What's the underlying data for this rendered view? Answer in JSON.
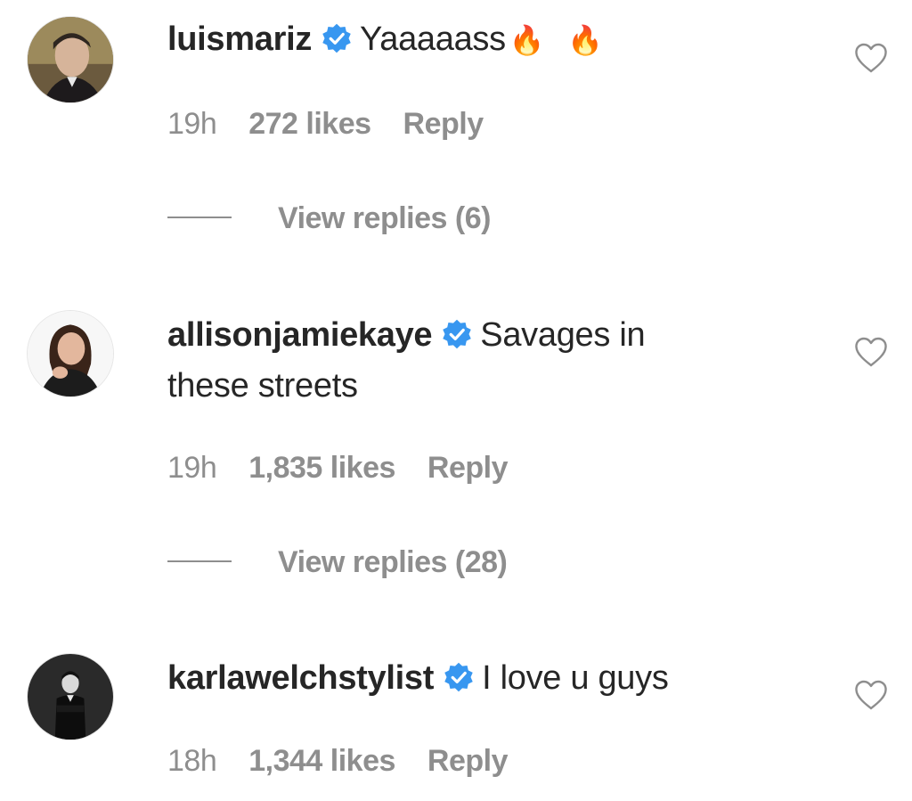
{
  "comments": [
    {
      "username": "luismariz",
      "verified_icon": "verified-badge-icon",
      "text": "Yaaaaass",
      "emoji": [
        "🔥",
        "🔥"
      ],
      "time": "19h",
      "likes": "272 likes",
      "reply_label": "Reply",
      "view_replies": "View replies (6)",
      "like_icon": "heart-outline-icon"
    },
    {
      "username": "allisonjamiekaye",
      "verified_icon": "verified-badge-icon",
      "text_line1": "Savages in",
      "text_line2": "these streets",
      "time": "19h",
      "likes": "1,835 likes",
      "reply_label": "Reply",
      "view_replies": "View replies (28)",
      "like_icon": "heart-outline-icon"
    },
    {
      "username": "karlawelchstylist",
      "verified_icon": "verified-badge-icon",
      "text": "I love u guys",
      "time": "18h",
      "likes": "1,344 likes",
      "reply_label": "Reply",
      "like_icon": "heart-outline-icon"
    }
  ],
  "colors": {
    "text": "#262626",
    "meta": "#8e8e8e",
    "verified": "#3897f0"
  }
}
